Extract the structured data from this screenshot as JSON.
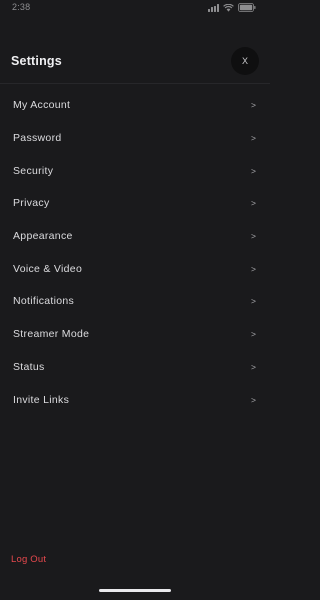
{
  "status_bar": {
    "time": "2:38"
  },
  "header": {
    "title": "Settings",
    "close_label": "X"
  },
  "menu": {
    "items": [
      {
        "label": "My Account",
        "chevron": ">"
      },
      {
        "label": "Password",
        "chevron": ">"
      },
      {
        "label": "Security",
        "chevron": ">"
      },
      {
        "label": "Privacy",
        "chevron": ">"
      },
      {
        "label": "Appearance",
        "chevron": ">"
      },
      {
        "label": "Voice & Video",
        "chevron": ">"
      },
      {
        "label": "Notifications",
        "chevron": ">"
      },
      {
        "label": "Streamer Mode",
        "chevron": ">"
      },
      {
        "label": "Status",
        "chevron": ">"
      },
      {
        "label": "Invite Links",
        "chevron": ">"
      }
    ]
  },
  "footer": {
    "logout_label": "Log Out"
  },
  "colors": {
    "background": "#1a1a1c",
    "logout": "#e5484d"
  },
  "icons": {
    "signal": "signal-icon",
    "wifi": "wifi-icon",
    "battery": "battery-icon",
    "close": "close-icon",
    "chevron": "chevron-right-icon"
  }
}
